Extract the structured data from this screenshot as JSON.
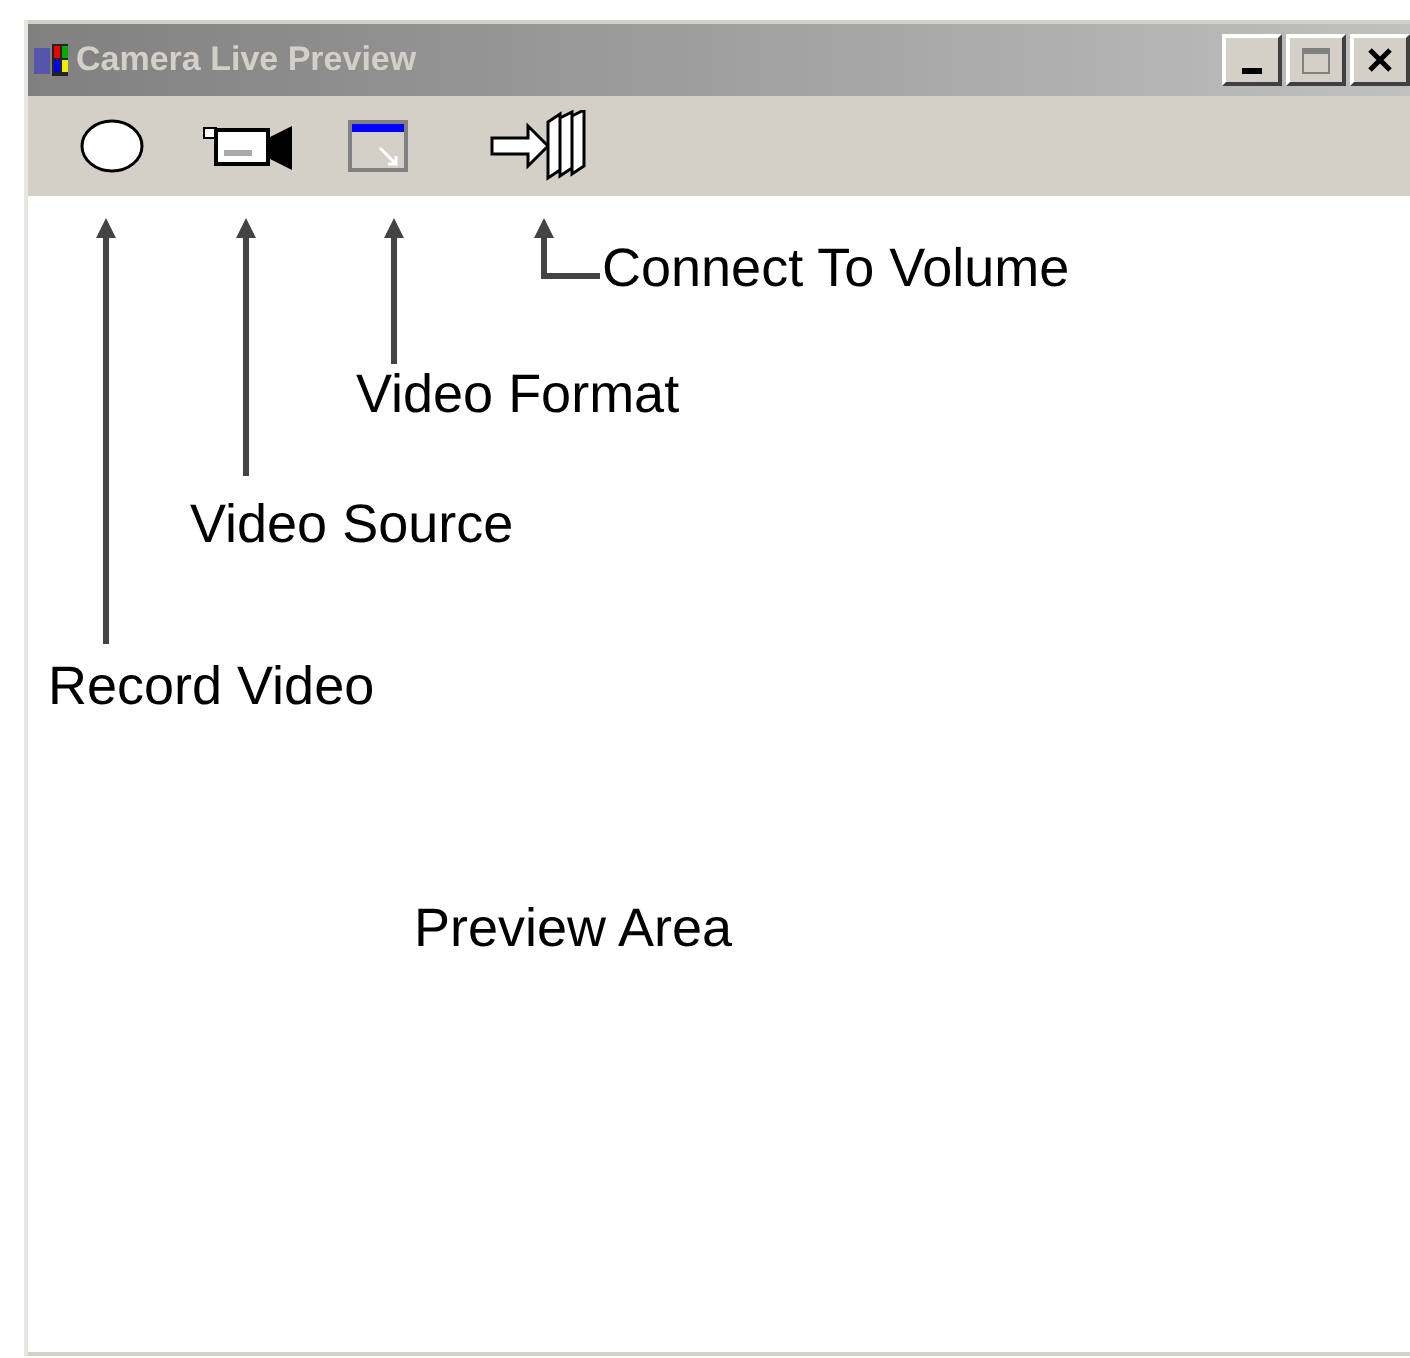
{
  "window": {
    "title": "Camera Live Preview"
  },
  "toolbar": [
    {
      "kind": "record"
    },
    {
      "kind": "source"
    },
    {
      "kind": "format"
    },
    {
      "kind": "volume"
    }
  ],
  "annotations": [
    {
      "text": "Connect To Volume",
      "kind": "elbow"
    },
    {
      "text": "Video Format",
      "kind": "straight"
    },
    {
      "text": "Video Source",
      "kind": "straight"
    },
    {
      "text": "Record Video",
      "kind": "straight"
    }
  ],
  "preview": {
    "label": "Preview Area"
  }
}
